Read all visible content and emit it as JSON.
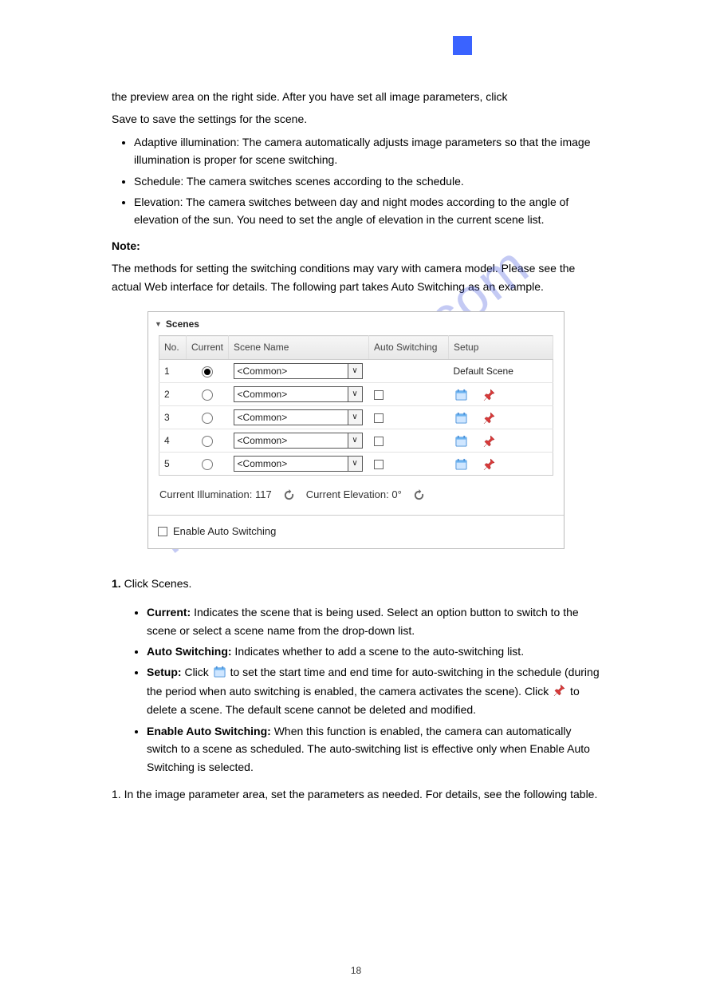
{
  "page_number": "18",
  "main": {
    "intro": "the preview area on the right side. After you have set all image parameters, click",
    "intro_b": "Save to save the settings for the scene.",
    "bullets": [
      "Adaptive illumination: The camera automatically adjusts image parameters so that the image illumination is proper for scene switching.",
      "Schedule: The camera switches scenes according to the schedule.",
      "Elevation: The camera switches between day and night modes according to the angle of elevation of the sun. You need to set the angle of elevation in the current scene list."
    ],
    "note_label": "Note:",
    "note_para": "The methods for setting the switching conditions may vary with camera model. Please see the actual Web interface for details. The following part takes Auto Switching as an example."
  },
  "screenshot": {
    "title": "Scenes",
    "columns": {
      "no": "No.",
      "current": "Current",
      "scene_name": "Scene Name",
      "auto_switching": "Auto Switching",
      "setup": "Setup"
    },
    "rows": [
      {
        "no": "1",
        "current": true,
        "name": "<Common>",
        "has_auto": false,
        "setup_text": "Default Scene"
      },
      {
        "no": "2",
        "current": false,
        "name": "<Common>",
        "has_auto": true
      },
      {
        "no": "3",
        "current": false,
        "name": "<Common>",
        "has_auto": true
      },
      {
        "no": "4",
        "current": false,
        "name": "<Common>",
        "has_auto": true
      },
      {
        "no": "5",
        "current": false,
        "name": "<Common>",
        "has_auto": true
      }
    ],
    "illumination_label": "Current Illumination:",
    "illumination_value": "117",
    "elevation_label": "Current Elevation:",
    "elevation_value": "0°",
    "enable_label": "Enable Auto Switching"
  },
  "steps": {
    "lead": "Click Scenes.",
    "items": [
      "<b>Current:</b> Indicates the scene that is being used. Select an option button to switch to the scene or select a scene name from the drop-down list.",
      "<b>Auto Switching:</b> Indicates whether to add a scene to the auto-switching list.",
      "<b>Setup:</b> Click  to set the start time and end time for auto-switching in the schedule (during the period when auto switching is enabled, the camera activates the scene). Click  to delete a scene. The default scene cannot be deleted and modified.",
      "<b>Enable Auto Switching:</b> When this function is enabled, the camera can automatically switch to a scene as scheduled. The auto-switching list is effective only when Enable Auto Switching is selected."
    ],
    "trailer": "1. In the image parameter area, set the parameters as needed. For details, see the following table."
  },
  "watermark": "manualshive.com"
}
